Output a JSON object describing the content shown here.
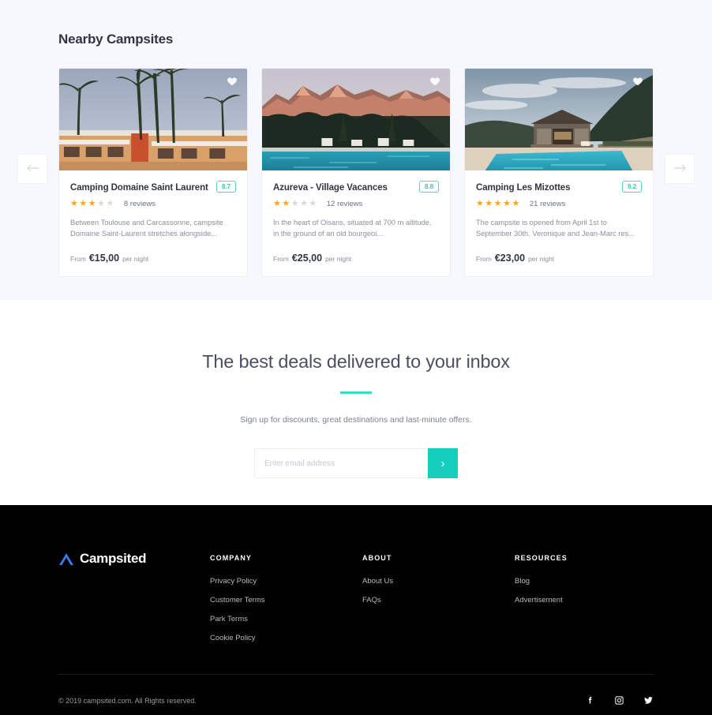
{
  "nearby": {
    "title": "Nearby Campsites",
    "prev_label": "Previous campsites",
    "next_label": "Next campsites",
    "cards": [
      {
        "name": "Camping Domaine Saint Laurent",
        "score": "8.7",
        "stars_filled": 3,
        "stars_total": 5,
        "reviews": "8 reviews",
        "description": "Between Toulouse and Carcassonne, campsite Domaine Saint-Laurent stretches alongside...",
        "price_from": "From",
        "price": "€15,00",
        "price_unit": "per night",
        "favourite_icon": "heart-icon",
        "image_alt": "palm trees over an orange apartment building"
      },
      {
        "name": "Azureva - Village Vacances",
        "score": "8.8",
        "stars_filled": 2,
        "stars_total": 5,
        "reviews": "12 reviews",
        "description": "In the heart of Oisans, situated at 700 m altitude, in the ground of an old bourgeoi...",
        "price_from": "From",
        "price": "€25,00",
        "price_unit": "per night",
        "favourite_icon": "heart-icon",
        "image_alt": "swimming pool with sunlit mountains at dusk"
      },
      {
        "name": "Camping Les Mizottes",
        "score": "9.2",
        "stars_filled": 5,
        "stars_total": 5,
        "reviews": "21 reviews",
        "description": "The campsite is opened from April 1st to September 30th. Veronique and Jean-Marc res...",
        "price_from": "From",
        "price": "€23,00",
        "price_unit": "per night",
        "favourite_icon": "heart-icon",
        "image_alt": "pool house beside a blue swimming pool"
      }
    ]
  },
  "newsletter": {
    "heading": "The best deals delivered to your inbox",
    "subheading": "Sign up for discounts, great destinations and last-minute offers.",
    "email_placeholder": "Enter email address",
    "email_value": "",
    "submit_label": "›",
    "accent_color": "#3fd9c6"
  },
  "footer": {
    "brand": "Campsited",
    "columns": [
      {
        "title": "COMPANY",
        "links": [
          "Privacy Policy",
          "Customer Terms",
          "Park Terms",
          "Cookie Policy"
        ]
      },
      {
        "title": "ABOUT",
        "links": [
          "About Us",
          "FAQs"
        ]
      },
      {
        "title": "RESOURCES",
        "links": [
          "Blog",
          "Advertisement"
        ]
      }
    ],
    "copyright": "© 2019 campsited.com. All Rights reserved.",
    "socials": [
      "facebook-icon",
      "instagram-icon",
      "twitter-icon"
    ]
  }
}
